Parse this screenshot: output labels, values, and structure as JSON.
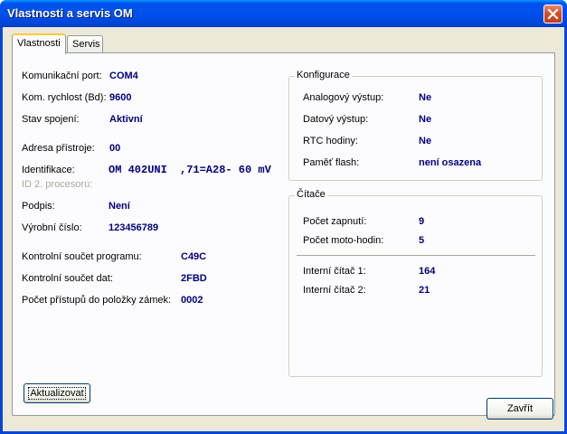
{
  "window": {
    "title": "Vlastnosti a servis OM"
  },
  "tabs": [
    {
      "label": "Vlastnosti"
    },
    {
      "label": "Servis"
    }
  ],
  "left": {
    "port_label": "Komunikační port:",
    "port_value": "COM4",
    "speed_label": "Kom. rychlost (Bd):",
    "speed_value": "9600",
    "state_label": "Stav spojení:",
    "state_value": "Aktivní",
    "addr_label": "Adresa přístroje:",
    "addr_value": "00",
    "ident_label": "Identifikace:",
    "ident_value": "OM 402UNI",
    "ident_extra": ",71=A28- 60 mV",
    "ident2_label": "ID 2. procesoru:",
    "sign_label": "Podpis:",
    "sign_value": "Není",
    "serial_label": "Výrobní číslo:",
    "serial_value": "123456789",
    "prog_checksum_label": "Kontrolní součet programu:",
    "prog_checksum_value": "C49C",
    "data_checksum_label": "Kontrolní součet dat:",
    "data_checksum_value": "2FBD",
    "access_label": "Počet přístupů do položky zámek:",
    "access_value": "0002"
  },
  "config": {
    "title": "Konfigurace",
    "analog_label": "Analogový výstup:",
    "analog_value": "Ne",
    "data_label": "Datový výstup:",
    "data_value": "Ne",
    "rtc_label": "RTC hodiny:",
    "rtc_value": "Ne",
    "flash_label": "Paměť flash:",
    "flash_value": "není osazena"
  },
  "counters": {
    "title": "Čítače",
    "poweron_label": "Počet zapnutí:",
    "poweron_value": "9",
    "motohours_label": "Počet moto-hodin:",
    "motohours_value": "5",
    "c1_label": "Interní čítač 1:",
    "c1_value": "164",
    "c2_label": "Interní čítač 2:",
    "c2_value": "21"
  },
  "buttons": {
    "refresh": "Aktualizovat",
    "close": "Zavřít"
  },
  "icons": {
    "close": "close-icon"
  }
}
